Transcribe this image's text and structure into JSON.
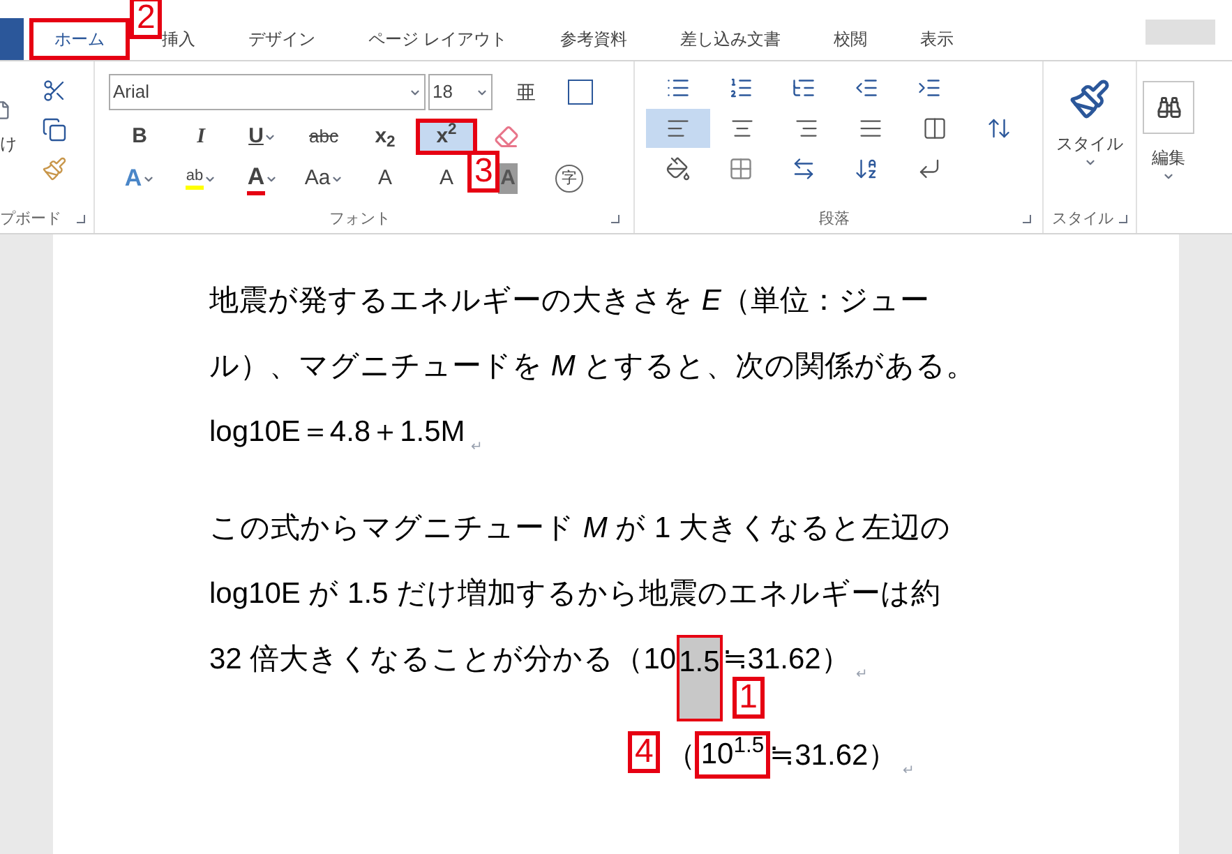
{
  "tabs": [
    {
      "label": "ホーム",
      "selected": true,
      "callout": "2"
    },
    {
      "label": "挿入",
      "selected": false
    },
    {
      "label": "デザイン",
      "selected": false
    },
    {
      "label": "ページ レイアウト",
      "selected": false
    },
    {
      "label": "参考資料",
      "selected": false
    },
    {
      "label": "差し込み文書",
      "selected": false
    },
    {
      "label": "校閲",
      "selected": false
    },
    {
      "label": "表示",
      "selected": false
    }
  ],
  "ribbon": {
    "clipboard": {
      "paste_label": "け",
      "label": "プボード"
    },
    "font": {
      "font_name": "Arial",
      "font_size": "18",
      "ruby_glyph": "亜",
      "label": "フォント",
      "row_1": [
        {
          "kind": "bold",
          "label": "B",
          "selected": false
        },
        {
          "kind": "italic",
          "label": "I",
          "selected": false
        },
        {
          "kind": "underline",
          "label": "U",
          "selected": false
        },
        {
          "kind": "strike",
          "label": "abc",
          "selected": false
        },
        {
          "kind": "script",
          "label": "x$_{2}$",
          "selected": false
        },
        {
          "kind": "script",
          "label": "x$^{2}$",
          "selected": true,
          "callout": "3"
        }
      ],
      "row_2": [
        {
          "kind": "effects",
          "label": "A"
        },
        {
          "kind": "highlight",
          "label": "ab"
        },
        {
          "kind": "color",
          "label": "A"
        },
        {
          "kind": "case",
          "label": "Aa"
        },
        {
          "kind": "grow",
          "label": "A"
        },
        {
          "kind": "shrink",
          "label": "A"
        },
        {
          "kind": "shade",
          "label": "A"
        },
        {
          "kind": "enclose",
          "label": "字"
        }
      ]
    },
    "paragraph": {
      "label": "段落",
      "alignment": [
        {
          "kind": "left",
          "selected": true
        },
        {
          "kind": "center",
          "selected": false
        },
        {
          "kind": "right",
          "selected": false
        },
        {
          "kind": "justify",
          "selected": false
        },
        {
          "kind": "distribute",
          "selected": false
        }
      ]
    },
    "styles": {
      "button": "スタイル",
      "label": "スタイル"
    },
    "editing": {
      "button": "編集"
    }
  },
  "document": {
    "paragraphs": [
      {
        "lines": [
          {
            "parts": [
              {
                "text": "地震が発するエネルギーの大きさを *E*（単位：ジュー"
              }
            ]
          },
          {
            "parts": [
              {
                "text": "ル）、マグニチュードを *M* とすると、次の関係がある。"
              }
            ]
          },
          {
            "parts": [
              {
                "text": "log10E＝4.8＋1.5M"
              }
            ],
            "mark": "↵"
          }
        ]
      },
      {
        "lines": [
          {
            "parts": [
              {
                "text": "この式からマグニチュード *M* が 1 大きくなると左辺の"
              }
            ]
          },
          {
            "parts": [
              {
                "text": "log10E が 1.5 だけ増加するから地震のエネルギーは約"
              }
            ]
          },
          {
            "parts": [
              {
                "text": "32 倍大きくなることが分かる（10"
              },
              {
                "text": "1.5",
                "selected": true,
                "callout": "1"
              },
              {
                "text": "≒31.62）"
              }
            ],
            "mark": "↵"
          }
        ]
      },
      {
        "lines": [
          {
            "callout": "4",
            "parts": [
              {
                "text": "（"
              },
              {
                "text": "10$^{1.5}$",
                "selected": false,
                "boxed": true
              },
              {
                "text": "≒31.62）"
              }
            ],
            "mark": "↵"
          }
        ]
      }
    ]
  }
}
